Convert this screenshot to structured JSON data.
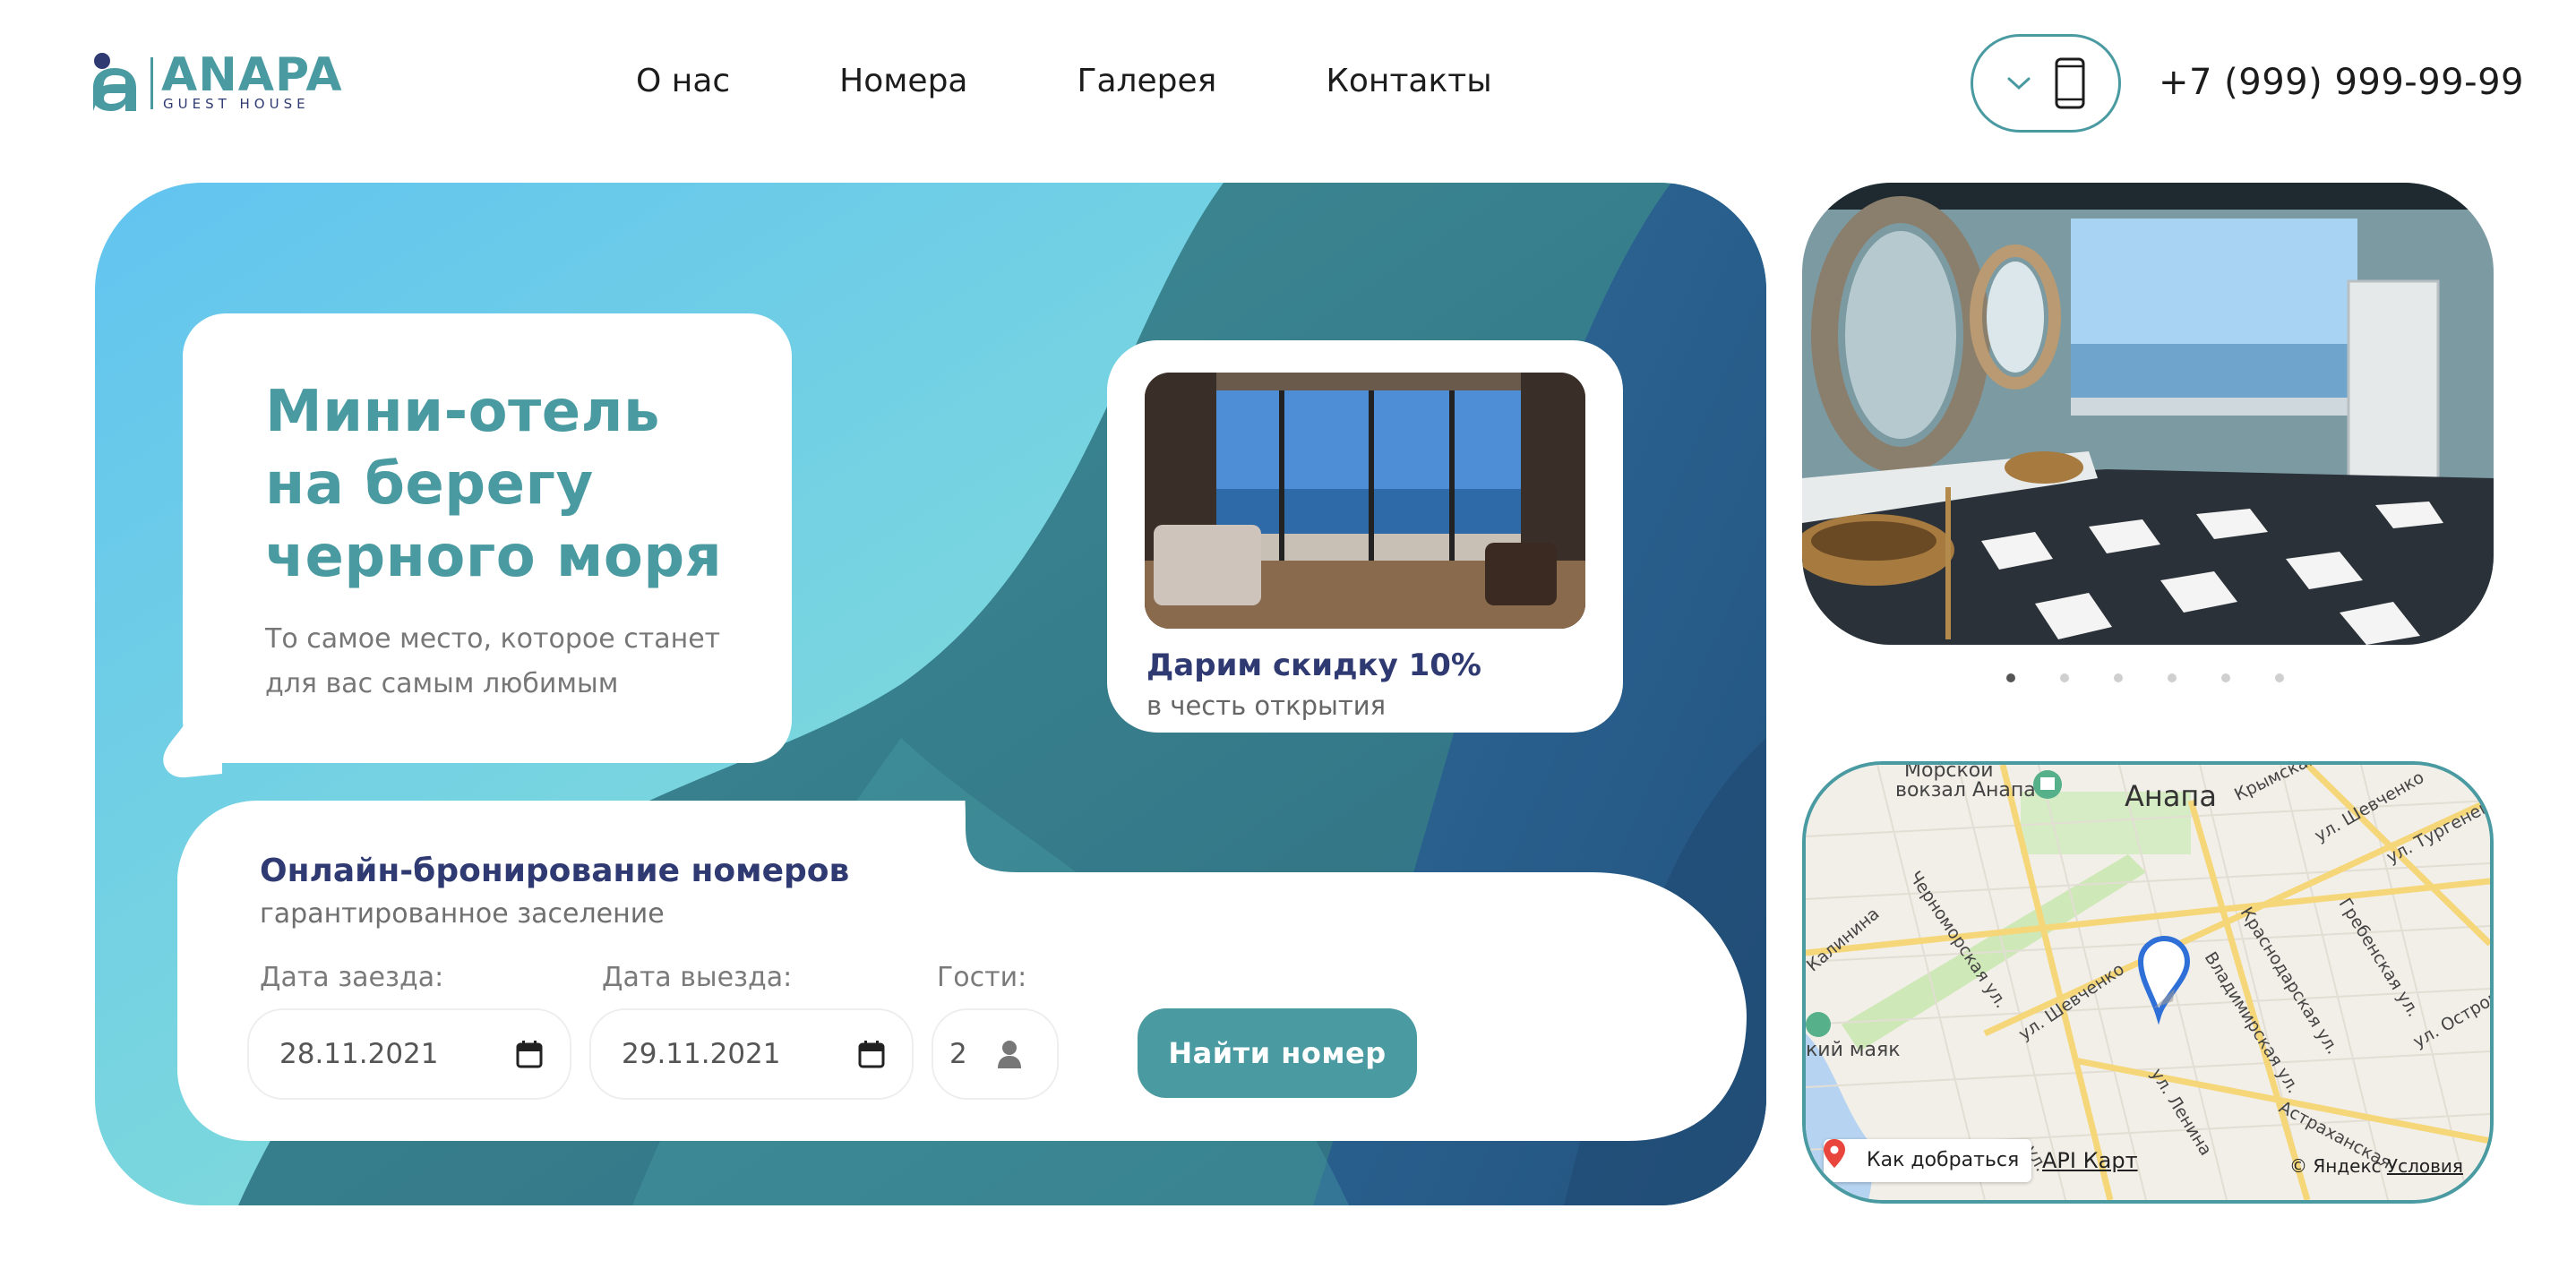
{
  "header": {
    "logo": {
      "title": "ANAPA",
      "subtitle": "GUEST HOUSE"
    },
    "nav": [
      {
        "label": "О нас"
      },
      {
        "label": "Номера"
      },
      {
        "label": "Галерея"
      },
      {
        "label": "Контакты"
      }
    ],
    "phone": "+7 (999) 999-99-99"
  },
  "hero": {
    "title": "Мини-отель\nна берегу\nчерного моря",
    "subtitle": "То самое место, которое станет для вас самым любимым",
    "promo": {
      "title": "Дарим скидку 10%",
      "subtitle": "в честь открытия"
    },
    "booking": {
      "title": "Онлайн-бронирование номеров",
      "subtitle": "гарантированное заселение",
      "checkin_label": "Дата заезда:",
      "checkin_value": "28.11.2021",
      "checkout_label": "Дата выезда:",
      "checkout_value": "29.11.2021",
      "guests_label": "Гости:",
      "guests_value": "2",
      "submit_label": "Найти номер"
    }
  },
  "gallery": {
    "slides": 6,
    "active_index": 0
  },
  "map": {
    "city": "Анапа",
    "poi": [
      "Морской",
      "вокзал Анапа",
      "кий маяк"
    ],
    "streets": [
      "Крымская",
      "ул. Шевченко",
      "ул. Тургенева",
      "Черноморская ул.",
      "Краснодарская ул.",
      "Гребенская ул.",
      "Калинина",
      "ул. Шевченко",
      "Владимирская ул.",
      "ул. Островс",
      "ул. Ленина",
      "Астраханская",
      "ул."
    ],
    "route_label": "Как добраться",
    "api_label": "API Карт",
    "copyright": "© Яндекс",
    "terms": "Условия"
  },
  "colors": {
    "accent": "#4a9aa2",
    "navy": "#2f3a72",
    "text": "#1c1c1c",
    "muted": "#777777"
  }
}
